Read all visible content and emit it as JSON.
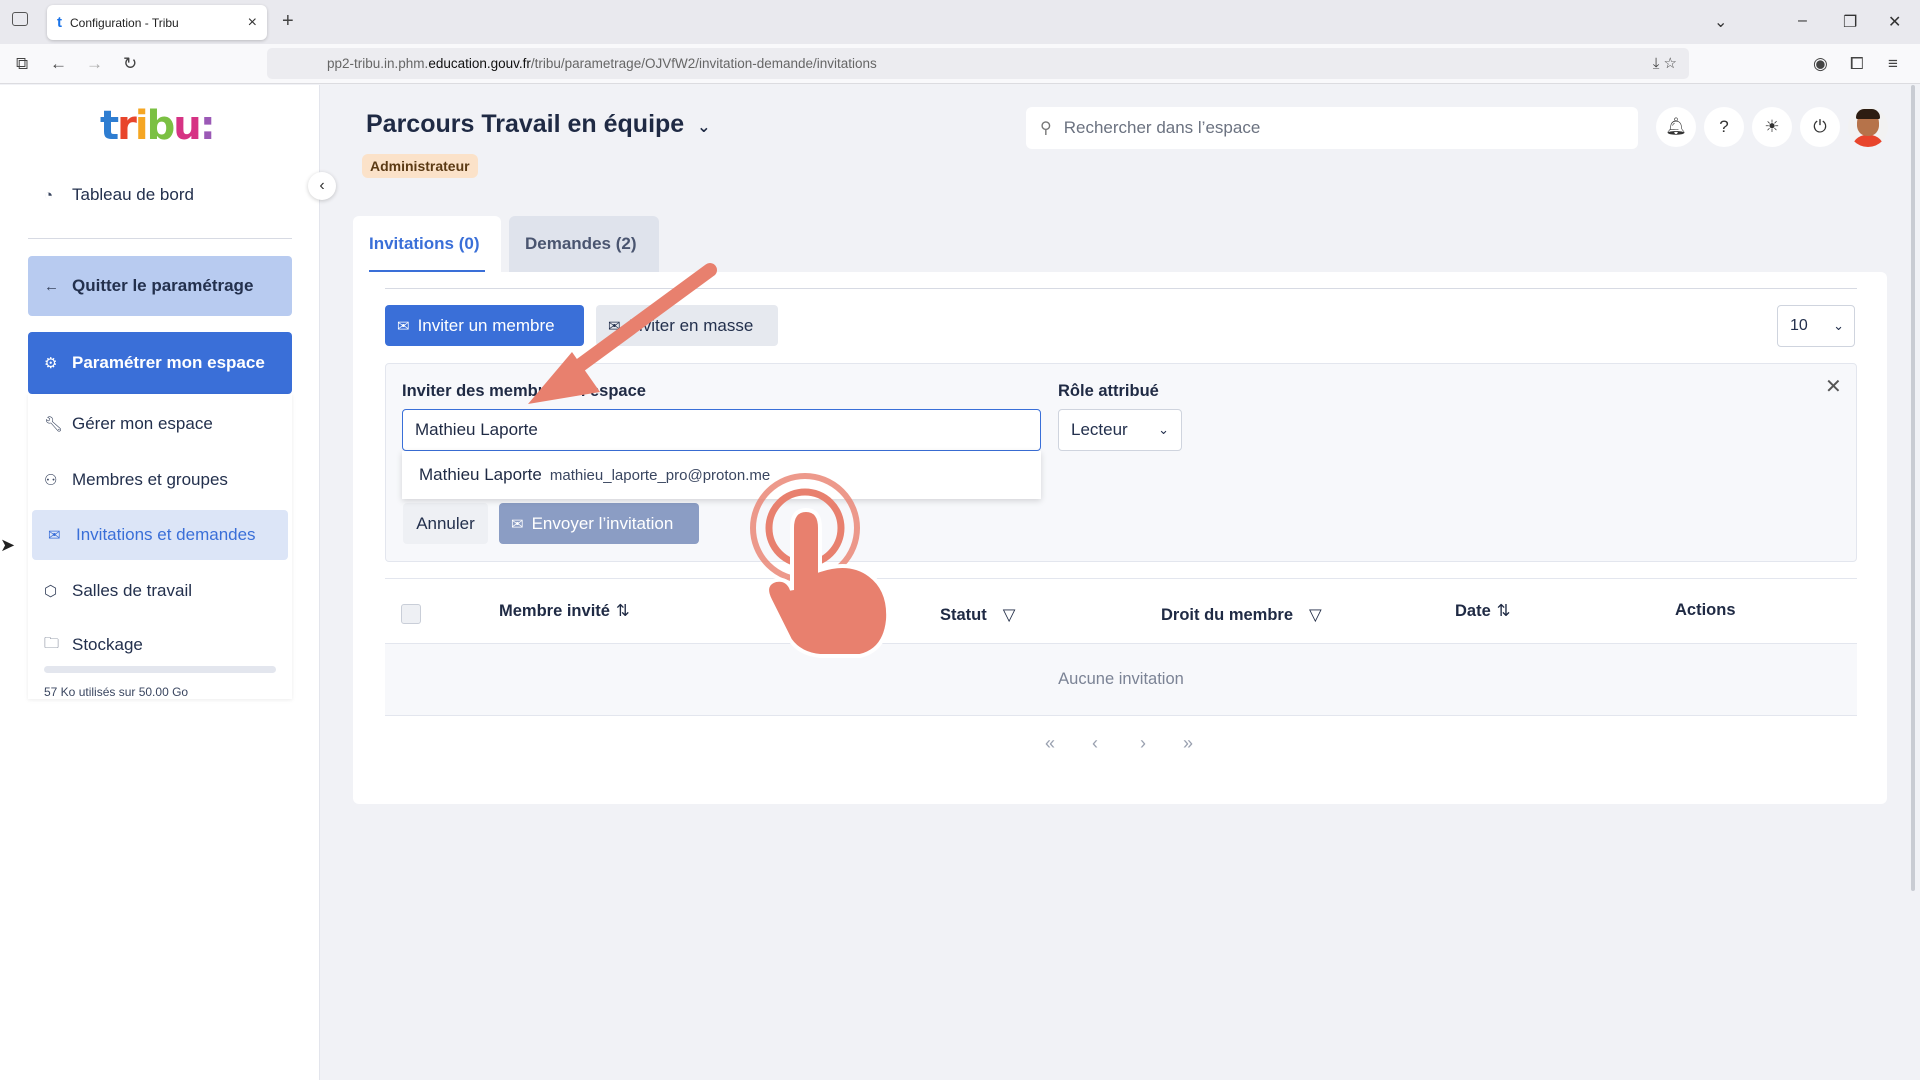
{
  "browser": {
    "tab_title": "Configuration - Tribu",
    "url_prefix": "pp2-tribu.in.phm.",
    "url_domain": "education.gouv.fr",
    "url_path": "/tribu/parametrage/OJVfW2/invitation-demande/invitations"
  },
  "sidebar": {
    "logo": [
      "t",
      "r",
      "i",
      "b",
      "u",
      ":"
    ],
    "dashboard": "Tableau de bord",
    "quit": "Quitter le paramétrage",
    "configure": "Paramétrer mon espace",
    "items": [
      {
        "label": "Gérer mon espace",
        "icon": "wrench-icon"
      },
      {
        "label": "Membres et groupes",
        "icon": "users-icon"
      },
      {
        "label": "Invitations et demandes",
        "icon": "mail-icon"
      },
      {
        "label": "Salles de travail",
        "icon": "cube-icon"
      },
      {
        "label": "Stockage",
        "icon": "folder-icon"
      }
    ],
    "storage_text": "57 Ko utilisés sur 50.00 Go"
  },
  "header": {
    "title": "Parcours Travail en équipe",
    "role_badge": "Administrateur",
    "search_placeholder": "Rechercher dans l’espace"
  },
  "tabs": {
    "invitations": "Invitations (0)",
    "requests": "Demandes (2)"
  },
  "toolbar": {
    "invite_member": "Inviter un membre",
    "invite_mass": "Inviter en masse",
    "per_page": "10"
  },
  "invite_form": {
    "members_label": "Inviter des membres à l’espace",
    "input_value": "Mathieu Laporte",
    "role_label": "Rôle attribué",
    "role_value": "Lecteur",
    "suggestion_name": "Mathieu Laporte",
    "suggestion_email": "mathieu_laporte_pro@proton.me",
    "cancel": "Annuler",
    "send": "Envoyer l’invitation"
  },
  "table": {
    "columns": [
      "Membre invité",
      "Statut",
      "Droit du membre",
      "Date",
      "Actions"
    ],
    "empty": "Aucune invitation"
  },
  "pager": [
    "«",
    "‹",
    "›",
    "»"
  ],
  "colors": {
    "primary": "#3a6fd8",
    "badge_bg": "#fbe2c9",
    "annotation": "#e8806e"
  }
}
